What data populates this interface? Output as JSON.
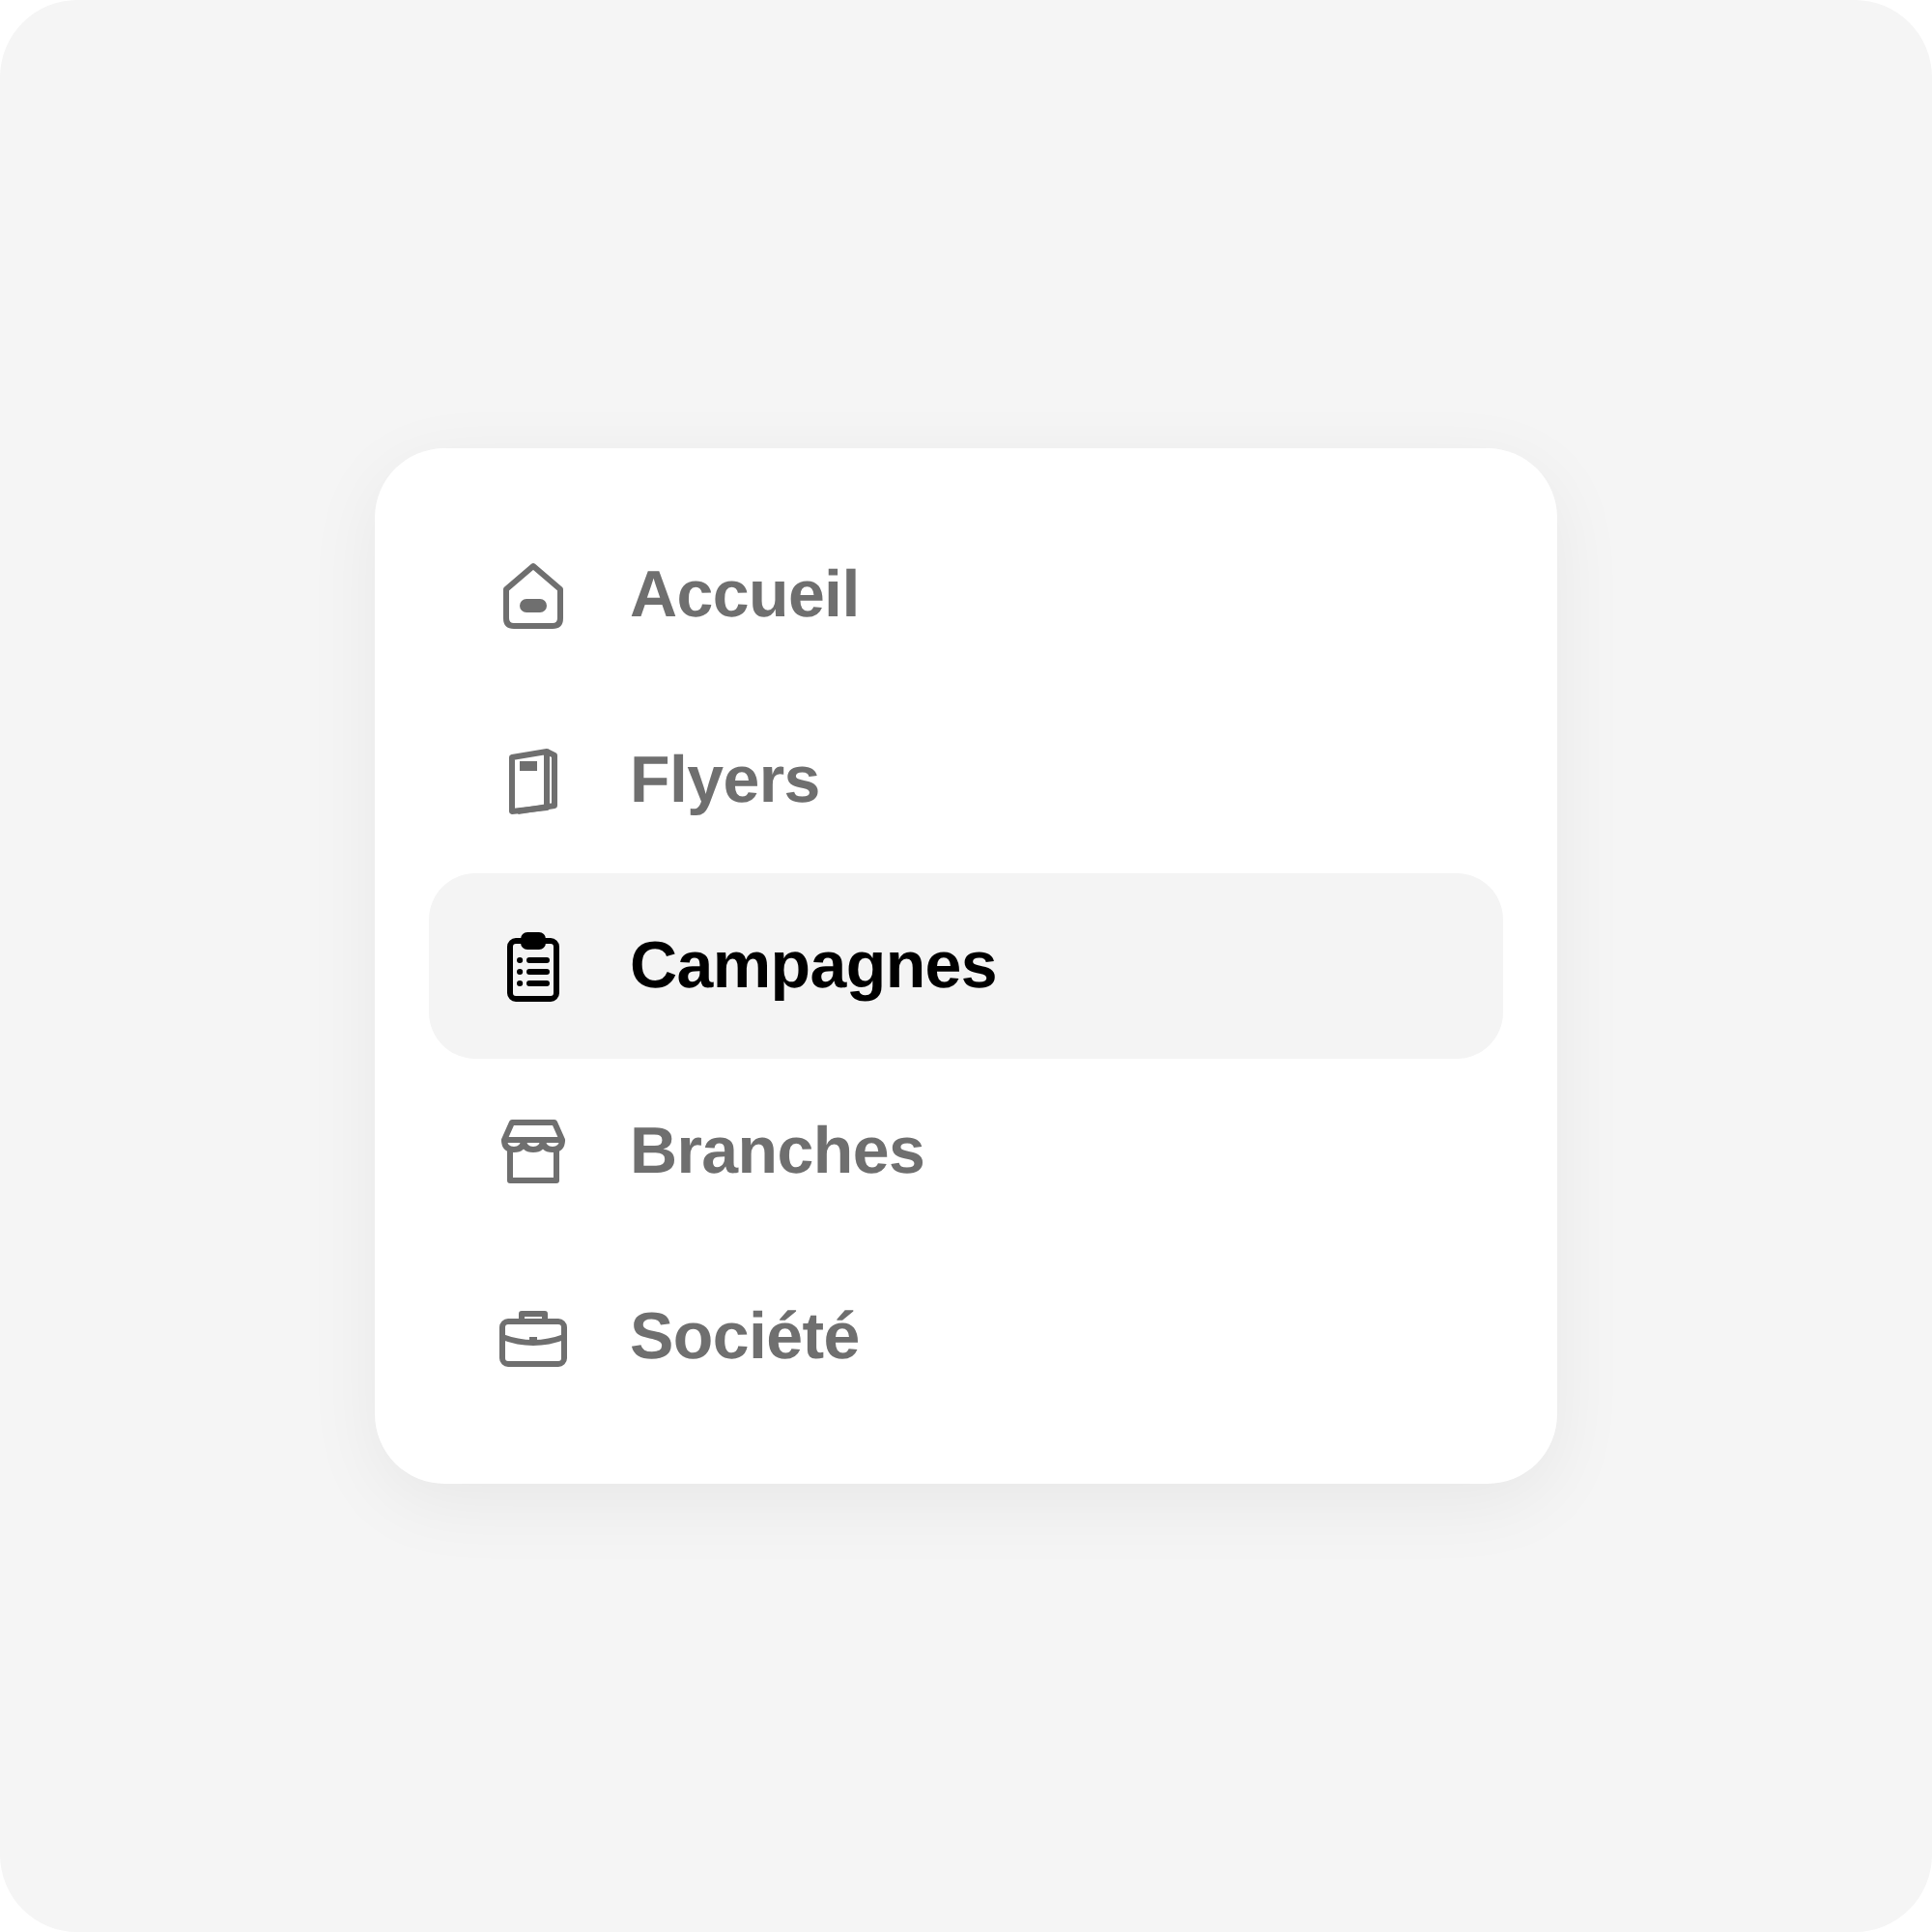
{
  "menu": {
    "items": [
      {
        "label": "Accueil",
        "selected": false
      },
      {
        "label": "Flyers",
        "selected": false
      },
      {
        "label": "Campagnes",
        "selected": true
      },
      {
        "label": "Branches",
        "selected": false
      },
      {
        "label": "Société",
        "selected": false
      }
    ]
  }
}
